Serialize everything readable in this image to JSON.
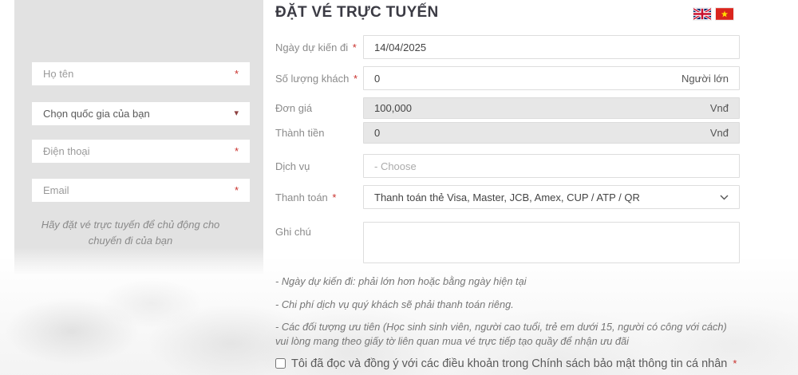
{
  "required_mark": "*",
  "page": {
    "title": "ĐẶT VÉ TRỰC TUYẾN"
  },
  "language_switcher": {
    "icons": [
      "uk-flag",
      "vietnam-flag"
    ]
  },
  "sidebar": {
    "name_placeholder": "Họ tên",
    "country_placeholder": "Chọn quốc gia của bạn",
    "phone_placeholder": "Điện thoại",
    "email_placeholder": "Email",
    "note": "Hãy đặt vé trực tuyến để chủ động cho chuyến đi của bạn"
  },
  "form": {
    "date": {
      "label": "Ngày dự kiến đi",
      "value": "14/04/2025"
    },
    "quantity": {
      "label": "Số lượng khách",
      "value": "0",
      "suffix": "Người lớn"
    },
    "unit_price": {
      "label": "Đơn giá",
      "value": "100,000",
      "suffix": "Vnđ"
    },
    "total": {
      "label": "Thành tiền",
      "value": "0",
      "suffix": "Vnđ"
    },
    "service": {
      "label": "Dịch vụ",
      "placeholder": "- Choose"
    },
    "payment": {
      "label": "Thanh toán",
      "value": "Thanh toán thẻ Visa, Master, JCB, Amex, CUP / ATP / QR"
    },
    "note_field": {
      "label": "Ghi chú"
    },
    "notes": [
      "- Ngày dự kiến đi: phải lớn hơn hoặc bằng ngày hiện tại",
      "- Chi phí dịch vụ quý khách sẽ phải thanh toán riêng.",
      "- Các đối tượng ưu tiên (Học sinh sinh viên, người cao tuổi, trẻ em dưới 15, người có công với cách) vui lòng mang theo giấy tờ liên quan mua vé trực tiếp tạo quầy để nhận ưu đãi"
    ],
    "agreement": "Tôi đã đọc và đồng ý với các điều khoản trong Chính sách bảo mật thông tin cá nhân"
  },
  "colors": {
    "accent_red": "#c9302c",
    "title_text": "#3b3b44",
    "label_text": "#8b8b8b",
    "sidebar_bg": "#e2e2e2",
    "disabled_bg": "#e7e7e7",
    "border": "#dddddd",
    "uk_flag_blue": "#012169",
    "flag_red": "#c8102e",
    "vn_flag_red": "#da251d",
    "vn_star_yellow": "#ffde00"
  }
}
